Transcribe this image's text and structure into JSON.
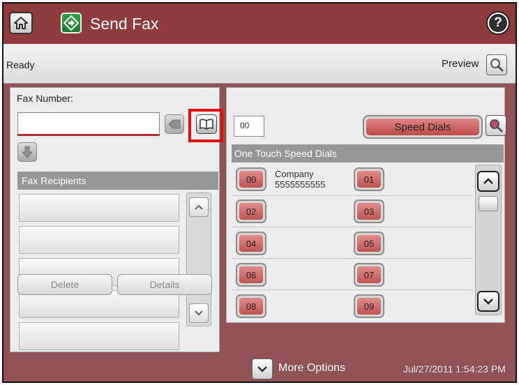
{
  "header": {
    "title": "Send Fax",
    "home_icon": "home-icon",
    "app_icon": "send-fax-icon",
    "help_label": "?"
  },
  "status": {
    "text": "Ready",
    "preview_label": "Preview"
  },
  "fax_number": {
    "label": "Fax Number:",
    "value": ""
  },
  "recipients": {
    "header": "Fax Recipients",
    "rows": [
      "",
      "",
      "",
      "",
      ""
    ],
    "delete_label": "Delete",
    "details_label": "Details"
  },
  "speed_dial": {
    "input_value": "00",
    "button_label": "Speed Dials",
    "header": "One Touch Speed Dials",
    "entries": [
      {
        "code": "00",
        "name": "Company",
        "number": "5555555555"
      },
      {
        "code": "01",
        "name": "",
        "number": ""
      },
      {
        "code": "02",
        "name": "",
        "number": ""
      },
      {
        "code": "03",
        "name": "",
        "number": ""
      },
      {
        "code": "04",
        "name": "",
        "number": ""
      },
      {
        "code": "05",
        "name": "",
        "number": ""
      },
      {
        "code": "06",
        "name": "",
        "number": ""
      },
      {
        "code": "07",
        "name": "",
        "number": ""
      },
      {
        "code": "08",
        "name": "",
        "number": ""
      },
      {
        "code": "09",
        "name": "",
        "number": ""
      }
    ]
  },
  "footer": {
    "more_options_label": "More Options",
    "datetime": "Jul/27/2011 1:54:23 PM"
  },
  "colors": {
    "title_bar": "#8f3a3c",
    "background": "#915255",
    "speed_dial_button": "#c05353",
    "highlight": "#e01010"
  }
}
